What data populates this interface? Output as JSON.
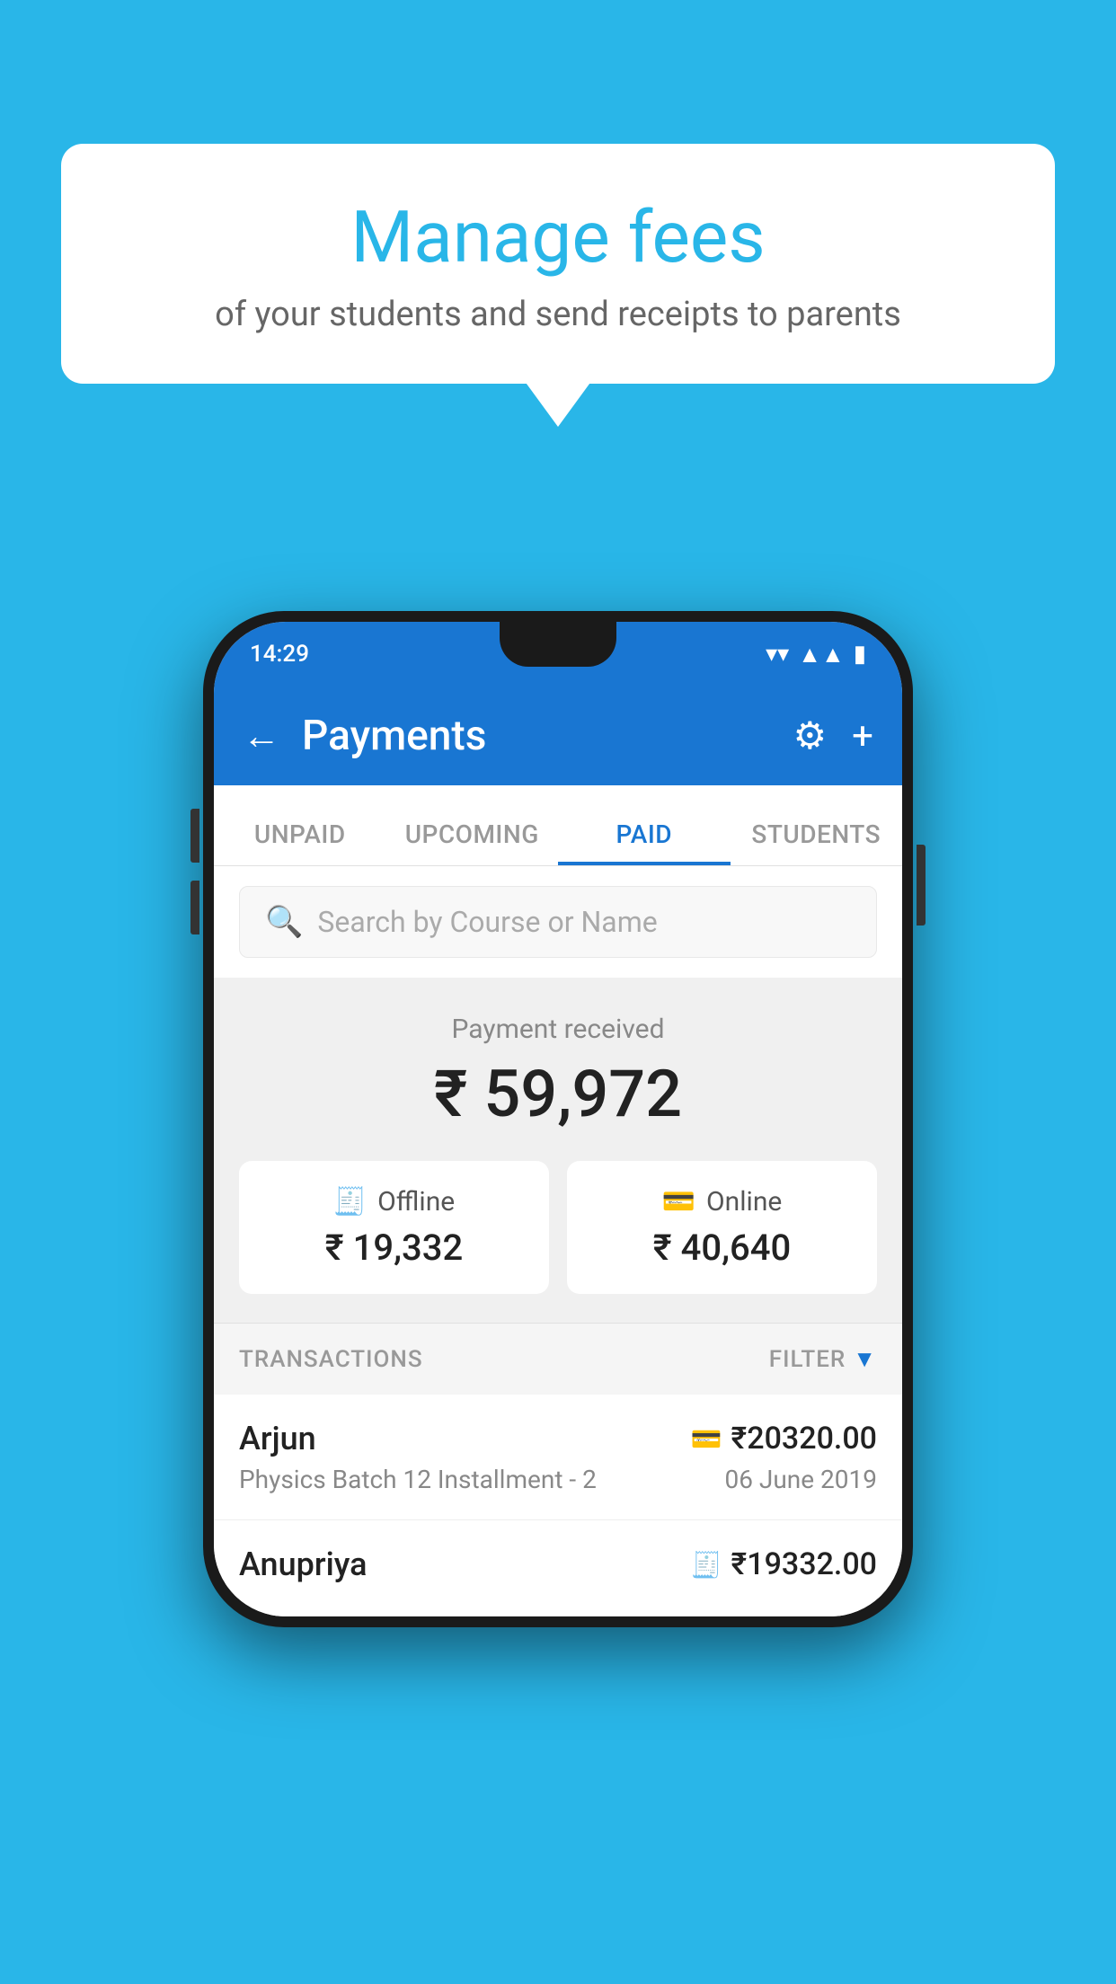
{
  "background_color": "#29b6e8",
  "bubble": {
    "title": "Manage fees",
    "subtitle": "of your students and send receipts to parents"
  },
  "phone": {
    "status_bar": {
      "time": "14:29",
      "wifi": "▼",
      "signal": "▲",
      "battery": "▮"
    },
    "app_bar": {
      "title": "Payments",
      "back_label": "←",
      "gear_label": "⚙",
      "plus_label": "+"
    },
    "tabs": [
      {
        "id": "unpaid",
        "label": "UNPAID",
        "active": false
      },
      {
        "id": "upcoming",
        "label": "UPCOMING",
        "active": false
      },
      {
        "id": "paid",
        "label": "PAID",
        "active": true
      },
      {
        "id": "students",
        "label": "STUDENTS",
        "active": false
      }
    ],
    "search": {
      "placeholder": "Search by Course or Name"
    },
    "payment_summary": {
      "label": "Payment received",
      "amount": "₹ 59,972",
      "offline_label": "Offline",
      "offline_amount": "₹ 19,332",
      "online_label": "Online",
      "online_amount": "₹ 40,640"
    },
    "transactions": {
      "section_label": "TRANSACTIONS",
      "filter_label": "FILTER",
      "rows": [
        {
          "name": "Arjun",
          "course": "Physics Batch 12 Installment - 2",
          "amount": "₹20320.00",
          "date": "06 June 2019",
          "type": "online"
        },
        {
          "name": "Anupriya",
          "course": "",
          "amount": "₹19332.00",
          "date": "",
          "type": "offline"
        }
      ]
    }
  }
}
